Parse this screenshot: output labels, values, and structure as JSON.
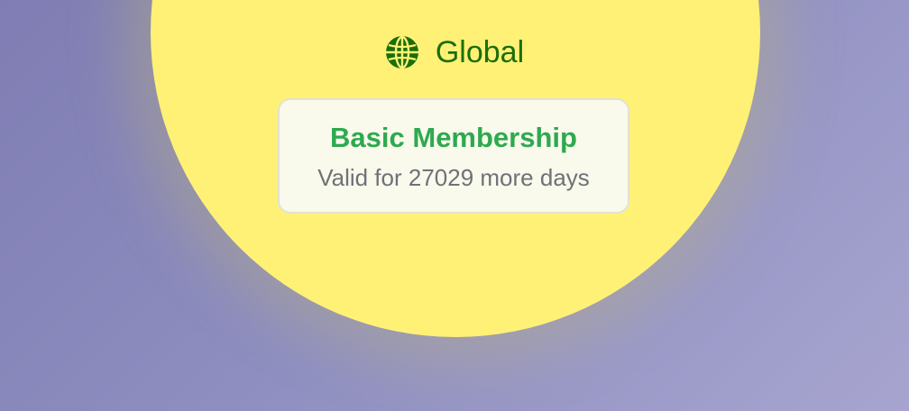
{
  "region": {
    "icon": "globe-icon",
    "label": "Global"
  },
  "membership": {
    "title": "Basic Membership",
    "validity": "Valid for 27029 more days"
  },
  "colors": {
    "circle": "#fff176",
    "region_text": "#1b6e0a",
    "title_text": "#2ea94f",
    "subtitle_text": "#6e7277",
    "card_background": "#f9f9ec"
  }
}
